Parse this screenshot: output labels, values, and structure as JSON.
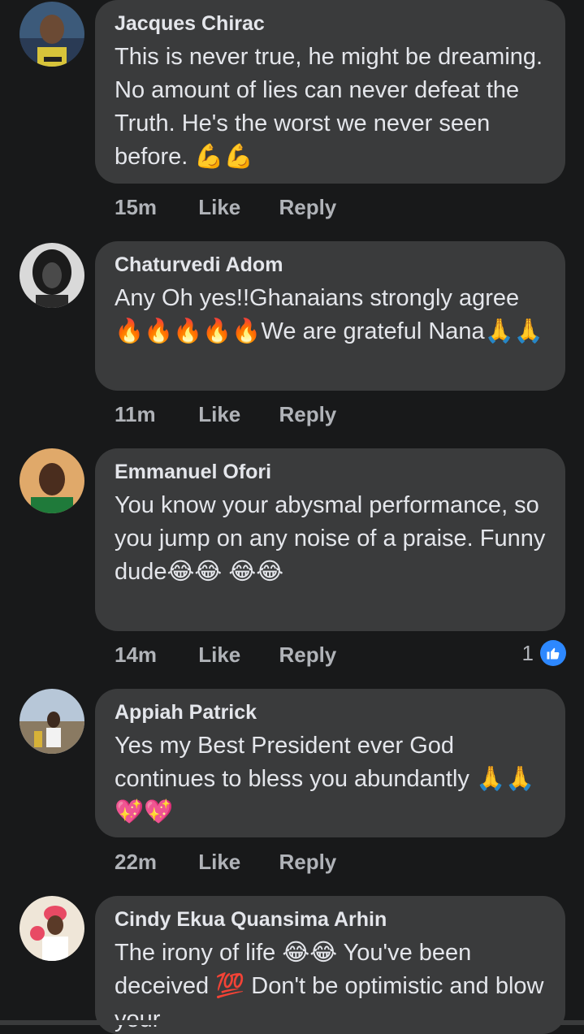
{
  "comments": [
    {
      "author": "Jacques Chirac",
      "text": "This is never true, he might be dreaming. No amount of lies can never defeat the Truth. He's the worst we never seen before. 💪💪",
      "time": "15m",
      "like_label": "Like",
      "reply_label": "Reply"
    },
    {
      "author": "Chaturvedi Adom",
      "text": "Any Oh yes!!Ghanaians strongly agree 🔥🔥🔥🔥🔥We are grateful Nana🙏🙏",
      "time": "11m",
      "like_label": "Like",
      "reply_label": "Reply"
    },
    {
      "author": "Emmanuel Ofori",
      "text": "You know your abysmal performance, so you jump on any noise of a praise. Funny dude😂😂 😂😂",
      "time": "14m",
      "like_label": "Like",
      "reply_label": "Reply",
      "reaction_count": "1"
    },
    {
      "author": "Appiah Patrick",
      "text": "Yes my Best President ever God continues to bless you abundantly 🙏🙏💖💖",
      "time": "22m",
      "like_label": "Like",
      "reply_label": "Reply"
    },
    {
      "author": "Cindy Ekua Quansima Arhin",
      "text": "The irony of life 😂😂 You've been deceived 💯 Don't be optimistic and blow your",
      "time": "",
      "like_label": "",
      "reply_label": ""
    }
  ],
  "colors": {
    "background": "#18191a",
    "bubble": "#3a3b3c",
    "meta": "#b0b3b8",
    "like_badge": "#2d88ff"
  },
  "icons": {
    "avatar": "avatar",
    "like_reaction": "thumbs-up-icon"
  }
}
